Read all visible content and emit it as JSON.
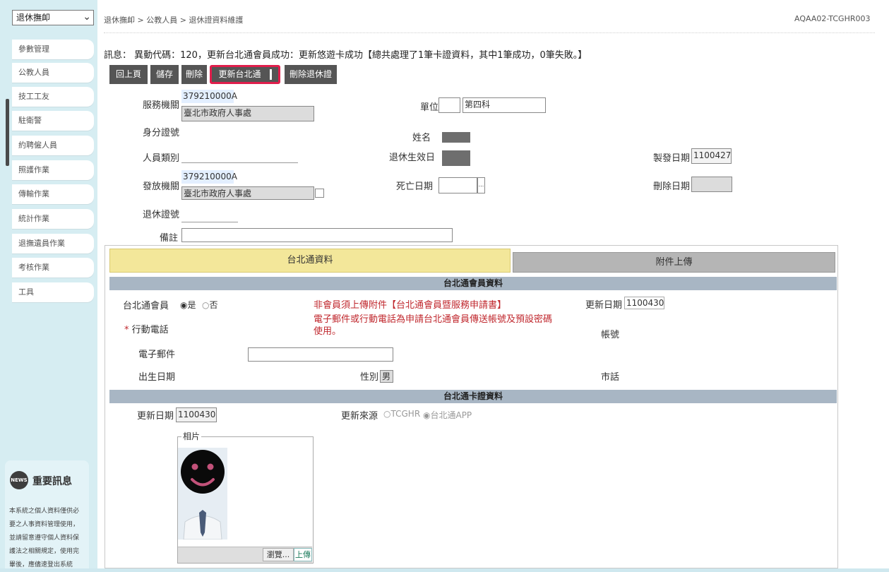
{
  "sidebar": {
    "select_value": "退休撫卹",
    "items": [
      "參數管理",
      "公教人員",
      "技工工友",
      "駐衛警",
      "約聘僱人員",
      "照護作業",
      "傳輸作業",
      "統計作業",
      "退撫遺員作業",
      "考核作業",
      "工具"
    ],
    "news_icon_text": "NEWS",
    "news_title": "重要訊息",
    "news_text": "本系統之個人資料僅供必要之人事資料管理使用，並請留意遵守個人資料保護法之相關規定，使用完畢後，應儘速登出系統"
  },
  "header": {
    "breadcrumb": "退休撫卹 > 公教人員 > 退休證資料維護",
    "page_code": "AQAA02-TCGHR003"
  },
  "message": "訊息： 異動代碼：120，更新台北通會員成功：更新悠遊卡成功【總共處理了1筆卡證資料，其中1筆成功，0筆失敗。】",
  "toolbar": {
    "back": "回上頁",
    "save": "儲存",
    "delete": "刪除",
    "update_taipei": "更新台北通",
    "delete_cert": "刪除退休證"
  },
  "form": {
    "org_label": "服務機關",
    "org_code": "379210000A",
    "org_name": "臺北市政府人事處",
    "unit_label": "單位",
    "unit_value": "第四科",
    "id_label": "身分證號",
    "name_label": "姓名",
    "person_type_label": "人員類別",
    "retire_date_label": "退休生效日",
    "issue_date_label": "製發日期",
    "issue_date": "1100427",
    "issuer_label": "發放機關",
    "issuer_code": "379210000A",
    "issuer_name": "臺北市政府人事處",
    "death_date_label": "死亡日期",
    "delete_date_label": "刪除日期",
    "cert_no_label": "退休證號",
    "note_label": "備註"
  },
  "tabs": {
    "taipei": "台北通資料",
    "attach": "附件上傳"
  },
  "member": {
    "section_title": "台北通會員資料",
    "member_label": "台北通會員",
    "yes": "是",
    "no": "否",
    "notice": "非會員須上傳附件【台北通會員暨服務申請書】",
    "update_date_label": "更新日期",
    "update_date": "1100430",
    "mobile_label": "行動電話",
    "mobile_notice": "電子郵件或行動電話為申請台北通會員傳送帳號及預設密碼使用。",
    "account_label": "帳號",
    "email_label": "電子郵件",
    "birth_label": "出生日期",
    "gender_label": "性別",
    "gender_value": "男",
    "city_label": "市話"
  },
  "card": {
    "section_title": "台北通卡證資料",
    "update_date_label": "更新日期",
    "update_date": "1100430",
    "source_label": "更新來源",
    "source_tcghr": "TCGHR",
    "source_app": "台北通APP",
    "photo_label": "相片",
    "browse": "瀏覽...",
    "upload": "上傳"
  }
}
